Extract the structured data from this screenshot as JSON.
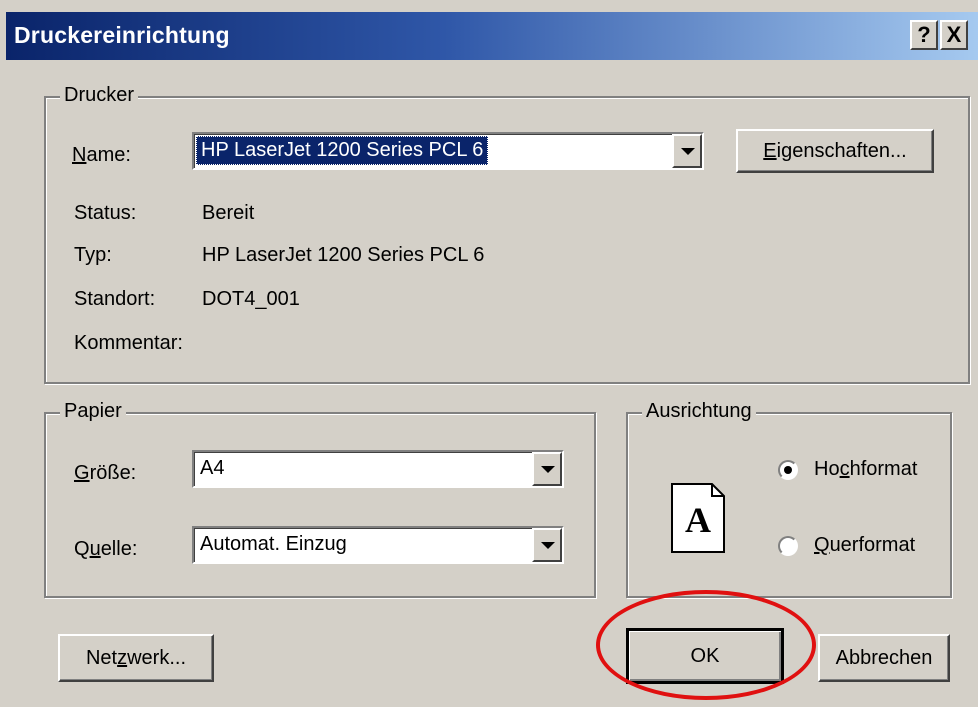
{
  "dialog": {
    "title": "Druckereinrichtung",
    "help_button": "?",
    "close_button": "X"
  },
  "printer_group": {
    "legend": "Drucker",
    "name_label": "Name:",
    "name_value": "HP LaserJet 1200 Series PCL 6",
    "properties_button": "Eigenschaften...",
    "status_label": "Status:",
    "status_value": "Bereit",
    "type_label": "Typ:",
    "type_value": "HP LaserJet 1200 Series PCL 6",
    "location_label": "Standort:",
    "location_value": "DOT4_001",
    "comment_label": "Kommentar:",
    "comment_value": ""
  },
  "paper_group": {
    "legend": "Papier",
    "size_label": "Größe:",
    "size_value": "A4",
    "source_label": "Quelle:",
    "source_value": "Automat. Einzug"
  },
  "orientation_group": {
    "legend": "Ausrichtung",
    "icon_letter": "A",
    "portrait_label": "Hochformat",
    "landscape_label": "Querformat",
    "selected": "Hochformat"
  },
  "buttons": {
    "network": "Netzwerk...",
    "ok": "OK",
    "cancel": "Abbrechen"
  },
  "colors": {
    "title_gradient_start": "#0a246a",
    "title_gradient_end": "#a6caf0",
    "highlight_circle": "#e01010",
    "dialog_face": "#d4d0c8"
  }
}
